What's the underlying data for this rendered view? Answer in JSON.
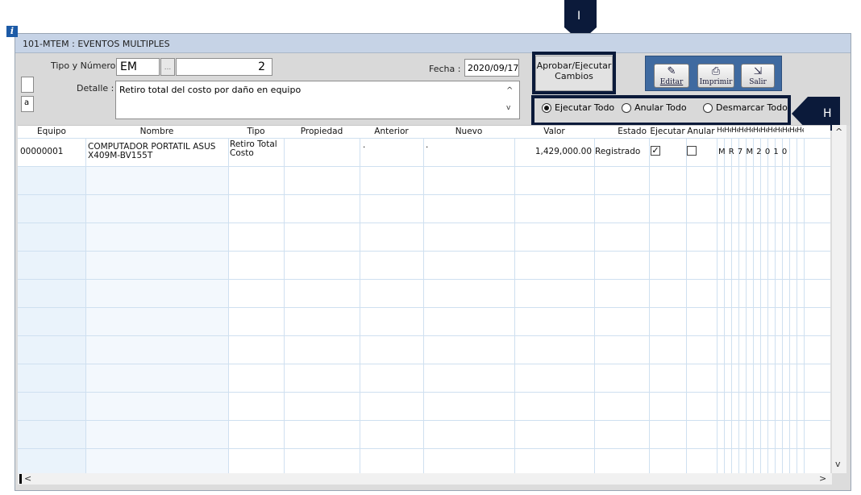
{
  "window": {
    "title": "101-MTEM : EVENTOS MULTIPLES"
  },
  "header": {
    "info_icon_glyph": "i",
    "side_box_label": "a",
    "tipo_label": "Tipo y Número :",
    "tipo_value": "EM",
    "tipo_dots": "...",
    "numero_value": "2",
    "fecha_label": "Fecha :",
    "fecha_value": "2020/09/17",
    "detalle_label": "Detalle :",
    "detalle_value": "Retiro total del costo por daño en equipo"
  },
  "actions": {
    "approve_line1": "Aprobar/Ejecutar",
    "approve_line2": "Cambios"
  },
  "toolbar": {
    "editar_label": "Editar",
    "imprimir_label": "Imprimir",
    "salir_label": "Salir"
  },
  "radios": {
    "ejecutar_todo": "Ejecutar Todo",
    "anular_todo": "Anular Todo",
    "desmarcar_todo": "Desmarcar Todo",
    "selected": "ejecutar_todo"
  },
  "grid": {
    "columns": [
      "Equipo",
      "Nombre",
      "Tipo",
      "Propiedad",
      "Anterior",
      "Nuevo",
      "Valor",
      "Estado",
      "Ejecutar",
      "Anular",
      "He"
    ],
    "rows": [
      {
        "equipo": "00000001",
        "nombre_line1": "COMPUTADOR PORTATIL ASUS",
        "nombre_line2": "X409M-BV155T",
        "tipo_line1": "Retiro Total",
        "tipo_line2": "Costo",
        "propiedad": "",
        "anterior": ".",
        "nuevo": ".",
        "valor": "1,429,000.00",
        "estado": "Registrado",
        "ejecutar": true,
        "anular": false,
        "extra": "M R 7 M 2 0 1 0"
      }
    ]
  },
  "annotations": {
    "marker_I": "I",
    "marker_H": "H"
  },
  "colors": {
    "accent": "#0b1a3a",
    "toolbar": "#3f6aa0",
    "titlebar": "#c6d3e6"
  }
}
